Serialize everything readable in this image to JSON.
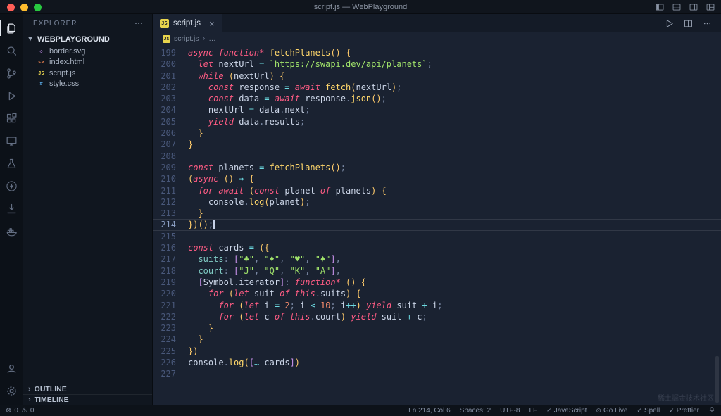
{
  "title_bar": {
    "title": "script.js — WebPlayground"
  },
  "activity_bar": {
    "items": [
      {
        "name": "explorer",
        "icon": "files",
        "active": true
      },
      {
        "name": "search",
        "icon": "search"
      },
      {
        "name": "source-control",
        "icon": "git"
      },
      {
        "name": "run-debug",
        "icon": "debug"
      },
      {
        "name": "extensions",
        "icon": "extensions"
      },
      {
        "name": "remote-explorer",
        "icon": "monitor"
      },
      {
        "name": "testing",
        "icon": "beaker"
      },
      {
        "name": "thunder-client",
        "icon": "bolt"
      },
      {
        "name": "downloads",
        "icon": "download"
      },
      {
        "name": "docker",
        "icon": "docker"
      }
    ],
    "bottom": [
      {
        "name": "accounts",
        "icon": "account"
      },
      {
        "name": "settings",
        "icon": "gear"
      }
    ]
  },
  "sidebar": {
    "header": {
      "title": "EXPLORER",
      "menu": "⋯"
    },
    "workspace": {
      "label": "WEBPLAYGROUND",
      "chevron": "▾"
    },
    "files": [
      {
        "name": "border.svg",
        "type": "svg",
        "badge": "◇"
      },
      {
        "name": "index.html",
        "type": "html",
        "badge": "<>"
      },
      {
        "name": "script.js",
        "type": "js",
        "badge": "JS"
      },
      {
        "name": "style.css",
        "type": "css",
        "badge": "#"
      }
    ],
    "chevron_collapsed": "›",
    "panels": [
      {
        "label": "OUTLINE"
      },
      {
        "label": "TIMELINE"
      }
    ]
  },
  "editor": {
    "js_badge": "JS",
    "tab": {
      "label": "script.js",
      "close_glyph": "×"
    },
    "breadcrumb": {
      "file": "script.js",
      "separator": "›",
      "more": "…"
    },
    "lines": [
      {
        "n": 199,
        "tokens": [
          [
            "kw",
            "async"
          ],
          [
            "plain",
            " "
          ],
          [
            "kw",
            "function*"
          ],
          [
            "plain",
            " "
          ],
          [
            "fn",
            "fetchPlanets"
          ],
          [
            "br",
            "()"
          ],
          [
            "plain",
            " "
          ],
          [
            "br",
            "{"
          ]
        ]
      },
      {
        "n": 200,
        "tokens": [
          [
            "plain",
            "  "
          ],
          [
            "kw",
            "let"
          ],
          [
            "plain",
            " nextUrl "
          ],
          [
            "op",
            "="
          ],
          [
            "plain",
            " "
          ],
          [
            "strlink",
            "`https://swapi.dev/api/planets`"
          ],
          [
            "punct",
            ";"
          ]
        ]
      },
      {
        "n": 201,
        "tokens": [
          [
            "plain",
            "  "
          ],
          [
            "kw",
            "while"
          ],
          [
            "plain",
            " "
          ],
          [
            "br",
            "("
          ],
          [
            "plain",
            "nextUrl"
          ],
          [
            "br",
            ")"
          ],
          [
            "plain",
            " "
          ],
          [
            "br",
            "{"
          ]
        ]
      },
      {
        "n": 202,
        "tokens": [
          [
            "plain",
            "    "
          ],
          [
            "kw",
            "const"
          ],
          [
            "plain",
            " response "
          ],
          [
            "op",
            "="
          ],
          [
            "plain",
            " "
          ],
          [
            "kw",
            "await"
          ],
          [
            "plain",
            " "
          ],
          [
            "fn",
            "fetch"
          ],
          [
            "br",
            "("
          ],
          [
            "plain",
            "nextUrl"
          ],
          [
            "br",
            ")"
          ],
          [
            "punct",
            ";"
          ]
        ]
      },
      {
        "n": 203,
        "tokens": [
          [
            "plain",
            "    "
          ],
          [
            "kw",
            "const"
          ],
          [
            "plain",
            " data "
          ],
          [
            "op",
            "="
          ],
          [
            "plain",
            " "
          ],
          [
            "kw",
            "await"
          ],
          [
            "plain",
            " response"
          ],
          [
            "punct",
            "."
          ],
          [
            "fn",
            "json"
          ],
          [
            "br",
            "()"
          ],
          [
            "punct",
            ";"
          ]
        ]
      },
      {
        "n": 204,
        "tokens": [
          [
            "plain",
            "    nextUrl "
          ],
          [
            "op",
            "="
          ],
          [
            "plain",
            " data"
          ],
          [
            "punct",
            "."
          ],
          [
            "plain",
            "next"
          ],
          [
            "punct",
            ";"
          ]
        ]
      },
      {
        "n": 205,
        "tokens": [
          [
            "plain",
            "    "
          ],
          [
            "kw",
            "yield"
          ],
          [
            "plain",
            " data"
          ],
          [
            "punct",
            "."
          ],
          [
            "plain",
            "results"
          ],
          [
            "punct",
            ";"
          ]
        ]
      },
      {
        "n": 206,
        "tokens": [
          [
            "plain",
            "  "
          ],
          [
            "br",
            "}"
          ]
        ]
      },
      {
        "n": 207,
        "tokens": [
          [
            "br",
            "}"
          ]
        ]
      },
      {
        "n": 208,
        "tokens": []
      },
      {
        "n": 209,
        "tokens": [
          [
            "kw",
            "const"
          ],
          [
            "plain",
            " planets "
          ],
          [
            "op",
            "="
          ],
          [
            "plain",
            " "
          ],
          [
            "fn",
            "fetchPlanets"
          ],
          [
            "br",
            "()"
          ],
          [
            "punct",
            ";"
          ]
        ]
      },
      {
        "n": 210,
        "tokens": [
          [
            "br",
            "("
          ],
          [
            "kw",
            "async"
          ],
          [
            "plain",
            " "
          ],
          [
            "br",
            "()"
          ],
          [
            "plain",
            " "
          ],
          [
            "op",
            "⇒"
          ],
          [
            "plain",
            " "
          ],
          [
            "br",
            "{"
          ]
        ]
      },
      {
        "n": 211,
        "tokens": [
          [
            "plain",
            "  "
          ],
          [
            "kw",
            "for"
          ],
          [
            "plain",
            " "
          ],
          [
            "kw",
            "await"
          ],
          [
            "plain",
            " "
          ],
          [
            "br",
            "("
          ],
          [
            "kw",
            "const"
          ],
          [
            "plain",
            " planet "
          ],
          [
            "kw",
            "of"
          ],
          [
            "plain",
            " planets"
          ],
          [
            "br",
            ")"
          ],
          [
            "plain",
            " "
          ],
          [
            "br",
            "{"
          ]
        ]
      },
      {
        "n": 212,
        "tokens": [
          [
            "plain",
            "    console"
          ],
          [
            "punct",
            "."
          ],
          [
            "fn",
            "log"
          ],
          [
            "br",
            "("
          ],
          [
            "plain",
            "planet"
          ],
          [
            "br",
            ")"
          ],
          [
            "punct",
            ";"
          ]
        ]
      },
      {
        "n": 213,
        "tokens": [
          [
            "plain",
            "  "
          ],
          [
            "br",
            "}"
          ]
        ]
      },
      {
        "n": 214,
        "current": true,
        "cursor": true,
        "tokens": [
          [
            "br",
            "})()"
          ],
          [
            "punct",
            ";"
          ]
        ]
      },
      {
        "n": 215,
        "tokens": []
      },
      {
        "n": 216,
        "tokens": [
          [
            "kw",
            "const"
          ],
          [
            "plain",
            " cards "
          ],
          [
            "op",
            "="
          ],
          [
            "plain",
            " "
          ],
          [
            "br",
            "({"
          ]
        ]
      },
      {
        "n": 217,
        "tokens": [
          [
            "plain",
            "  "
          ],
          [
            "prop",
            "suits"
          ],
          [
            "punct",
            ":"
          ],
          [
            "plain",
            " "
          ],
          [
            "sq",
            "["
          ],
          [
            "str",
            "\"♣\""
          ],
          [
            "punct",
            ", "
          ],
          [
            "str",
            "\"♦\""
          ],
          [
            "punct",
            ", "
          ],
          [
            "str",
            "\"♥\""
          ],
          [
            "punct",
            ", "
          ],
          [
            "str",
            "\"♠\""
          ],
          [
            "sq",
            "]"
          ],
          [
            "punct",
            ","
          ]
        ]
      },
      {
        "n": 218,
        "tokens": [
          [
            "plain",
            "  "
          ],
          [
            "prop",
            "court"
          ],
          [
            "punct",
            ":"
          ],
          [
            "plain",
            " "
          ],
          [
            "sq",
            "["
          ],
          [
            "str",
            "\"J\""
          ],
          [
            "punct",
            ", "
          ],
          [
            "str",
            "\"Q\""
          ],
          [
            "punct",
            ", "
          ],
          [
            "str",
            "\"K\""
          ],
          [
            "punct",
            ", "
          ],
          [
            "str",
            "\"A\""
          ],
          [
            "sq",
            "]"
          ],
          [
            "punct",
            ","
          ]
        ]
      },
      {
        "n": 219,
        "tokens": [
          [
            "plain",
            "  "
          ],
          [
            "sq",
            "["
          ],
          [
            "plain",
            "Symbol"
          ],
          [
            "punct",
            "."
          ],
          [
            "plain",
            "iterator"
          ],
          [
            "sq",
            "]"
          ],
          [
            "punct",
            ":"
          ],
          [
            "plain",
            " "
          ],
          [
            "kw",
            "function*"
          ],
          [
            "plain",
            " "
          ],
          [
            "br",
            "()"
          ],
          [
            "plain",
            " "
          ],
          [
            "br",
            "{"
          ]
        ]
      },
      {
        "n": 220,
        "tokens": [
          [
            "plain",
            "    "
          ],
          [
            "kw",
            "for"
          ],
          [
            "plain",
            " "
          ],
          [
            "br",
            "("
          ],
          [
            "kw",
            "let"
          ],
          [
            "plain",
            " suit "
          ],
          [
            "kw",
            "of"
          ],
          [
            "plain",
            " "
          ],
          [
            "kw",
            "this"
          ],
          [
            "punct",
            "."
          ],
          [
            "plain",
            "suits"
          ],
          [
            "br",
            ")"
          ],
          [
            "plain",
            " "
          ],
          [
            "br",
            "{"
          ]
        ]
      },
      {
        "n": 221,
        "tokens": [
          [
            "plain",
            "      "
          ],
          [
            "kw",
            "for"
          ],
          [
            "plain",
            " "
          ],
          [
            "br",
            "("
          ],
          [
            "kw",
            "let"
          ],
          [
            "plain",
            " i "
          ],
          [
            "op",
            "="
          ],
          [
            "plain",
            " "
          ],
          [
            "num",
            "2"
          ],
          [
            "punct",
            "; "
          ],
          [
            "plain",
            "i "
          ],
          [
            "op",
            "≤"
          ],
          [
            "plain",
            " "
          ],
          [
            "num",
            "10"
          ],
          [
            "punct",
            "; "
          ],
          [
            "plain",
            "i"
          ],
          [
            "op",
            "++"
          ],
          [
            "br",
            ")"
          ],
          [
            "plain",
            " "
          ],
          [
            "kw",
            "yield"
          ],
          [
            "plain",
            " suit "
          ],
          [
            "op",
            "+"
          ],
          [
            "plain",
            " i"
          ],
          [
            "punct",
            ";"
          ]
        ]
      },
      {
        "n": 222,
        "tokens": [
          [
            "plain",
            "      "
          ],
          [
            "kw",
            "for"
          ],
          [
            "plain",
            " "
          ],
          [
            "br",
            "("
          ],
          [
            "kw",
            "let"
          ],
          [
            "plain",
            " c "
          ],
          [
            "kw",
            "of"
          ],
          [
            "plain",
            " "
          ],
          [
            "kw",
            "this"
          ],
          [
            "punct",
            "."
          ],
          [
            "plain",
            "court"
          ],
          [
            "br",
            ")"
          ],
          [
            "plain",
            " "
          ],
          [
            "kw",
            "yield"
          ],
          [
            "plain",
            " suit "
          ],
          [
            "op",
            "+"
          ],
          [
            "plain",
            " c"
          ],
          [
            "punct",
            ";"
          ]
        ]
      },
      {
        "n": 223,
        "tokens": [
          [
            "plain",
            "    "
          ],
          [
            "br",
            "}"
          ]
        ]
      },
      {
        "n": 224,
        "tokens": [
          [
            "plain",
            "  "
          ],
          [
            "br",
            "}"
          ]
        ]
      },
      {
        "n": 225,
        "tokens": [
          [
            "br",
            "})"
          ]
        ]
      },
      {
        "n": 226,
        "tokens": [
          [
            "plain",
            "console"
          ],
          [
            "punct",
            "."
          ],
          [
            "fn",
            "log"
          ],
          [
            "br",
            "("
          ],
          [
            "sq",
            "["
          ],
          [
            "op",
            "…"
          ],
          [
            "plain",
            " cards"
          ],
          [
            "sq",
            "]"
          ],
          [
            "br",
            ")"
          ]
        ]
      },
      {
        "n": 227,
        "tokens": []
      }
    ]
  },
  "status_bar": {
    "left": {
      "error_icon": "⊗",
      "errors": "0",
      "warn_icon": "⚠",
      "warnings": "0"
    },
    "right": [
      {
        "id": "cursor-position",
        "label": "Ln 214, Col 6"
      },
      {
        "id": "indentation",
        "label": "Spaces: 2"
      },
      {
        "id": "encoding",
        "label": "UTF-8"
      },
      {
        "id": "eol",
        "label": "LF"
      },
      {
        "id": "language",
        "icon": "✓",
        "label": "JavaScript"
      },
      {
        "id": "go-live",
        "icon": "⊙",
        "label": "Go Live"
      },
      {
        "id": "spell",
        "icon": "✓",
        "label": "Spell"
      },
      {
        "id": "prettier",
        "icon": "✓",
        "label": "Prettier"
      }
    ]
  },
  "watermark": {
    "text": "稀土掘金技术社区"
  },
  "colors": {
    "kw": "#ff5c84",
    "fn": "#ffd76b",
    "str": "#a0e26a",
    "num": "#f78c6c",
    "op": "#6cd9e0",
    "punct": "#7a88a3",
    "br": "#ffcb6b",
    "sq": "#c792ea",
    "prop": "#80cbc4",
    "plain": "#ccd6e8",
    "lineno": "#49587a",
    "lineno-active": "#8ca0c6"
  }
}
